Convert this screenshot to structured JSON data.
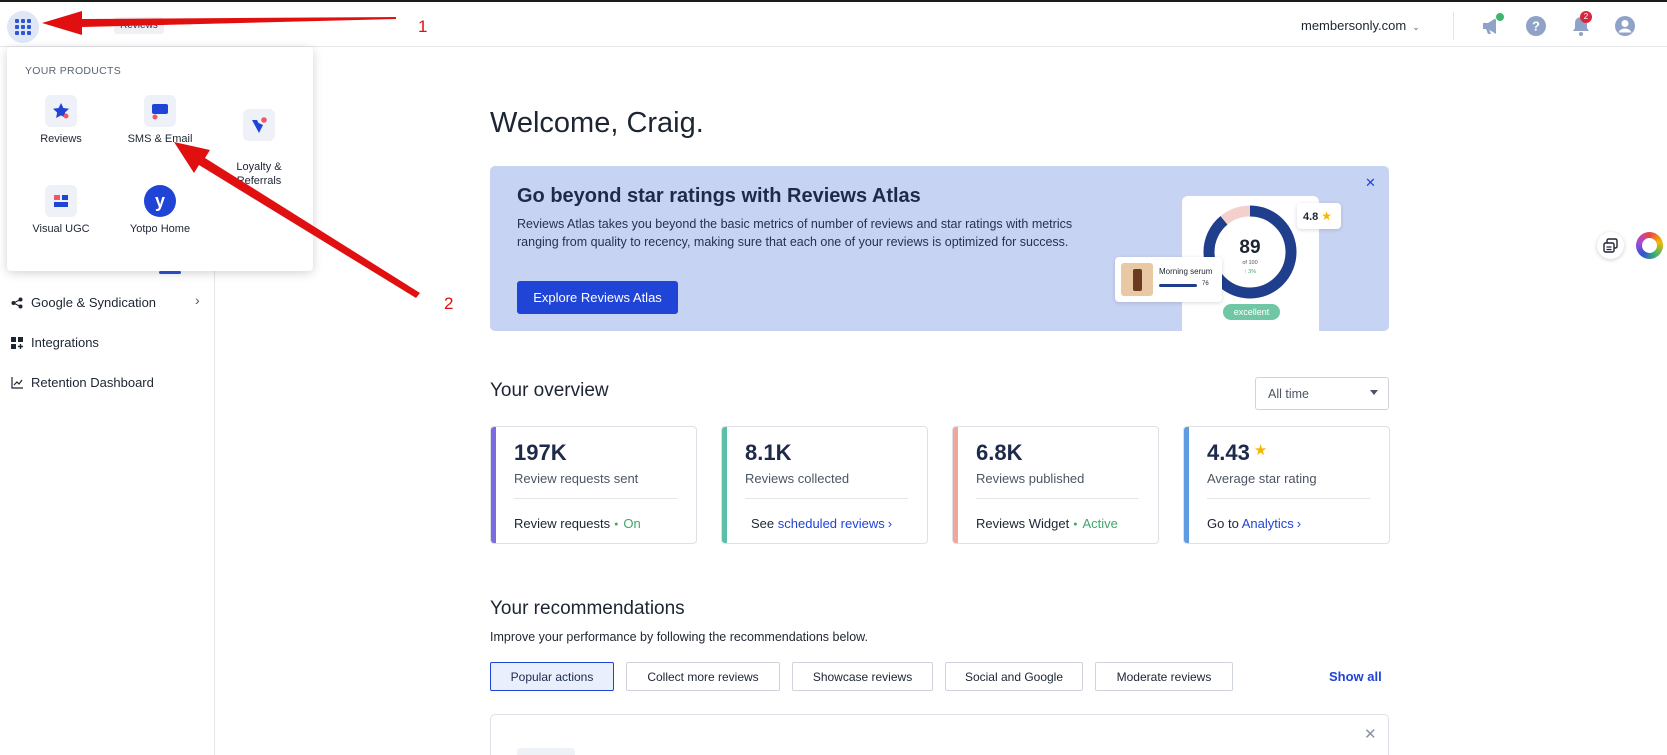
{
  "header": {
    "brand_tag": "Reviews",
    "store": "membersonly.com",
    "notification_count": "2"
  },
  "products_menu": {
    "title": "YOUR PRODUCTS",
    "items": [
      {
        "label": "Reviews",
        "icon": "star-icon"
      },
      {
        "label": "SMS & Email",
        "icon": "chat-icon"
      },
      {
        "label": "Loyalty &\nReferrals",
        "icon": "loyalty-icon"
      },
      {
        "label": "Visual UGC",
        "icon": "ugc-icon"
      },
      {
        "label": "Yotpo Home",
        "icon": "yotpo-logo-icon",
        "glyph": "y"
      }
    ]
  },
  "sidebar": {
    "items": [
      {
        "label": "Google & Syndication",
        "icon": "share-icon",
        "has_submenu": true
      },
      {
        "label": "Integrations",
        "icon": "grid-plus-icon"
      },
      {
        "label": "Retention Dashboard",
        "icon": "chart-line-icon"
      }
    ]
  },
  "main": {
    "welcome": "Welcome, Craig.",
    "banner": {
      "title": "Go beyond star ratings with Reviews Atlas",
      "body": "Reviews Atlas takes you beyond the basic metrics of number of reviews and star ratings with metrics ranging from quality to recency, making sure that each one of your reviews is optimized for success.",
      "cta": "Explore Reviews Atlas",
      "close": "✕",
      "illustration": {
        "score": "89",
        "score_sub": "of 100",
        "score_delta": "↑ 3%",
        "rating": "4.8",
        "product": "Morning serum",
        "product_score": "76",
        "grade": "excellent"
      }
    },
    "overview": {
      "title": "Your overview",
      "timeframe": "All time",
      "cards": [
        {
          "value": "197K",
          "label": "Review requests sent",
          "foot_text": "Review requests",
          "status": "On",
          "accent": "#7b6be0"
        },
        {
          "value": "8.1K",
          "label": "Reviews collected",
          "foot_text": "See",
          "link": "scheduled reviews",
          "accent": "#5cc0a8"
        },
        {
          "value": "6.8K",
          "label": "Reviews published",
          "foot_text": "Reviews Widget",
          "status": "Active",
          "accent": "#f0a79a"
        },
        {
          "value": "4.43",
          "label": "Average star rating",
          "foot_text": "Go to",
          "link": "Analytics",
          "accent": "#5f9be3"
        }
      ]
    },
    "recommendations": {
      "title": "Your recommendations",
      "subtitle": "Improve your performance by following the recommendations below.",
      "chips": [
        "Popular actions",
        "Collect more reviews",
        "Showcase reviews",
        "Social and Google",
        "Moderate reviews"
      ],
      "show_all": "Show all"
    }
  },
  "annotations": [
    "1",
    "2"
  ],
  "colors": {
    "accent": "#1f44d6",
    "banner": "#c7d3f2",
    "annotation": "#e01010"
  }
}
